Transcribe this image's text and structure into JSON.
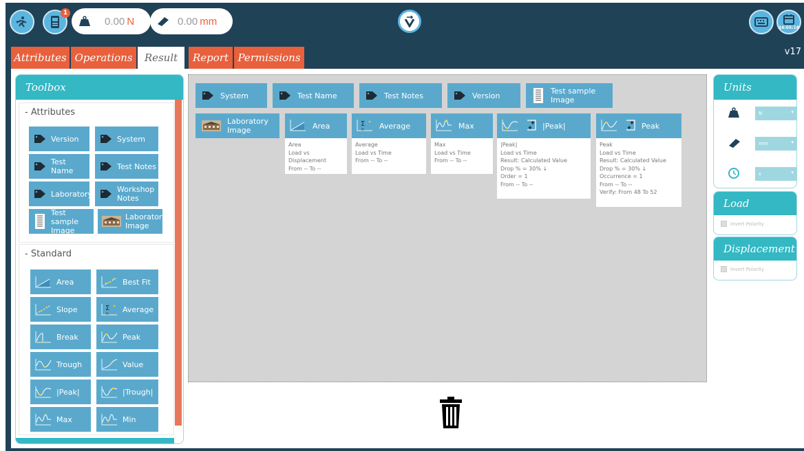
{
  "topbar": {
    "force_value": "0.00",
    "force_unit": "N",
    "distance_value": "0.00",
    "distance_unit": "mm",
    "notification_count": "1",
    "clock_time": "16:05:18",
    "icons": [
      "exit-icon",
      "device-icon",
      "weight-icon",
      "ruler-icon",
      "logo-icon",
      "keyboard-icon",
      "calendar-icon"
    ]
  },
  "tabs": [
    {
      "label": "Attributes",
      "active": false
    },
    {
      "label": "Operations",
      "active": false
    },
    {
      "label": "Result",
      "active": true
    },
    {
      "label": "Report",
      "active": false
    },
    {
      "label": "Permissions",
      "active": false
    }
  ],
  "version": "v17",
  "toolbox": {
    "title": "Toolbox",
    "attributes_title": "- Attributes",
    "attributes": [
      "Version",
      "System",
      "Test Name",
      "Test Notes",
      "Laboratory",
      "Workshop Notes",
      "Test sample Image",
      "Laboratory Image"
    ],
    "standard_title": "- Standard",
    "standard": [
      "Area",
      "Best Fit",
      "Slope",
      "Average",
      "Break",
      "Peak",
      "Trough",
      "Value",
      "|Peak|",
      "|Trough|",
      "Max",
      "Min"
    ]
  },
  "canvas": {
    "attr_cards": [
      "System",
      "Test Name",
      "Test Notes",
      "Version",
      "Test sample Image",
      "Laboratory Image"
    ],
    "results": [
      {
        "title": "Area",
        "lines": [
          "Area",
          "Load vs Displacement",
          "From -- To --"
        ]
      },
      {
        "title": "Average",
        "lines": [
          "Average",
          "Load vs Time",
          "From -- To --"
        ]
      },
      {
        "title": "Max",
        "lines": [
          "Max",
          "Load vs Time",
          "From -- To --"
        ]
      },
      {
        "title": "|Peak|",
        "lines": [
          "|Peak|",
          "Load vs Time",
          "Result: Calculated Value",
          "Drop % = 30% ↓",
          "Order = 1",
          "From -- To --"
        ]
      },
      {
        "title": "Peak",
        "lines": [
          "Peak",
          "Load vs Time",
          "Result: Calculated Value",
          "Drop % = 30% ↓",
          "Occurrence = 1",
          "From -- To --",
          "Verify: From 48 To 52"
        ]
      }
    ]
  },
  "units": {
    "title": "Units",
    "force": "N",
    "distance": "mm",
    "time": "s"
  },
  "load": {
    "title": "Load",
    "invert_label": "Invert Polarity"
  },
  "displacement": {
    "title": "Displacement",
    "invert_label": "Invert Polarity"
  },
  "colors": {
    "navy": "#1f4257",
    "orange": "#e8603c",
    "teal": "#33b8c4",
    "blue": "#5aa9cd"
  }
}
